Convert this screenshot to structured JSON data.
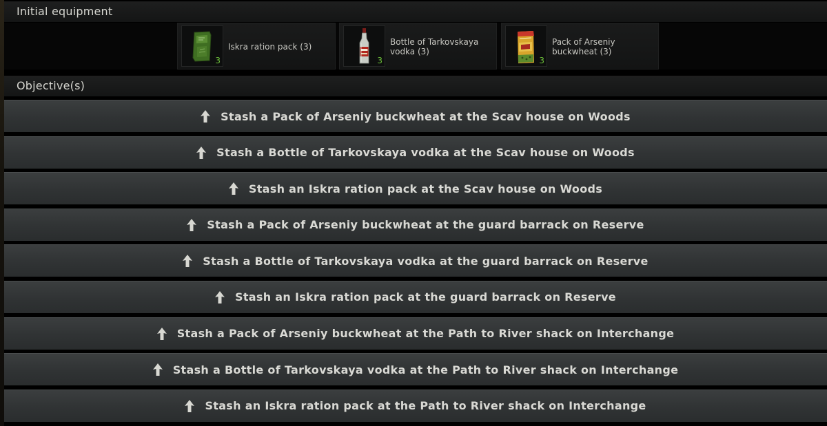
{
  "initial_equipment": {
    "title": "Initial equipment",
    "items": [
      {
        "label": "Iskra ration pack (3)",
        "count": "3",
        "icon": "ration-pack-icon"
      },
      {
        "label": "Bottle of Tarkovskaya vodka (3)",
        "count": "3",
        "icon": "vodka-bottle-icon"
      },
      {
        "label": "Pack of Arseniy buckwheat (3)",
        "count": "3",
        "icon": "buckwheat-pack-icon"
      }
    ]
  },
  "objectives": {
    "title": "Objective(s)",
    "items": [
      "Stash a Pack of Arseniy buckwheat at the Scav house on Woods",
      "Stash a Bottle of Tarkovskaya vodka at the Scav house on Woods",
      "Stash an Iskra ration pack at the Scav house on Woods",
      "Stash a Pack of Arseniy buckwheat at the guard barrack on Reserve",
      "Stash a Bottle of Tarkovskaya vodka at the guard barrack on Reserve",
      "Stash an Iskra ration pack at the guard barrack on Reserve",
      "Stash a Pack of Arseniy buckwheat at the Path to River shack on Interchange",
      "Stash a Bottle of Tarkovskaya vodka at the Path to River shack on Interchange",
      "Stash an Iskra ration pack at the Path to River shack on Interchange"
    ],
    "icon": "upload-arrow-icon"
  },
  "colors": {
    "count_green": "#6cbf3a",
    "text": "#d9d9d4",
    "row_bg": "#313435"
  }
}
